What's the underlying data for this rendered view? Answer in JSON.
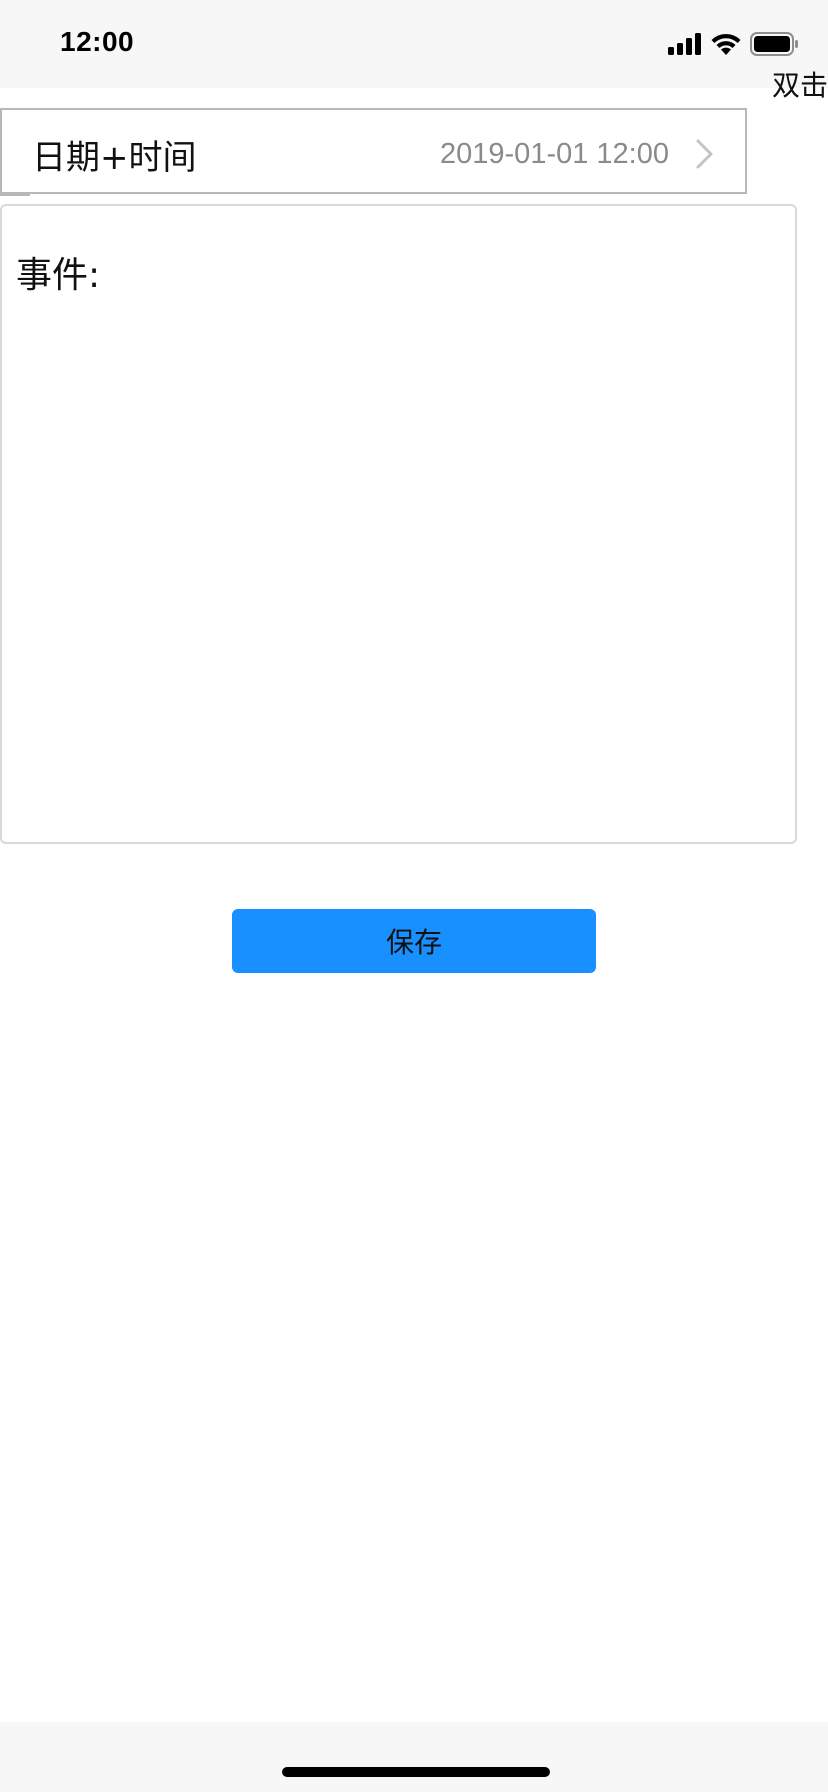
{
  "status_bar": {
    "time": "12:00",
    "icons": [
      "cellular-signal-icon",
      "wifi-icon",
      "battery-icon"
    ]
  },
  "double_tap_label": "双击",
  "datetime_row": {
    "label": "日期+时间",
    "value": "2019-01-01 12:00",
    "icon": "chevron-right-icon"
  },
  "event": {
    "label": "事件:",
    "value": ""
  },
  "save_button": {
    "label": "保存",
    "color": "#1890ff"
  }
}
